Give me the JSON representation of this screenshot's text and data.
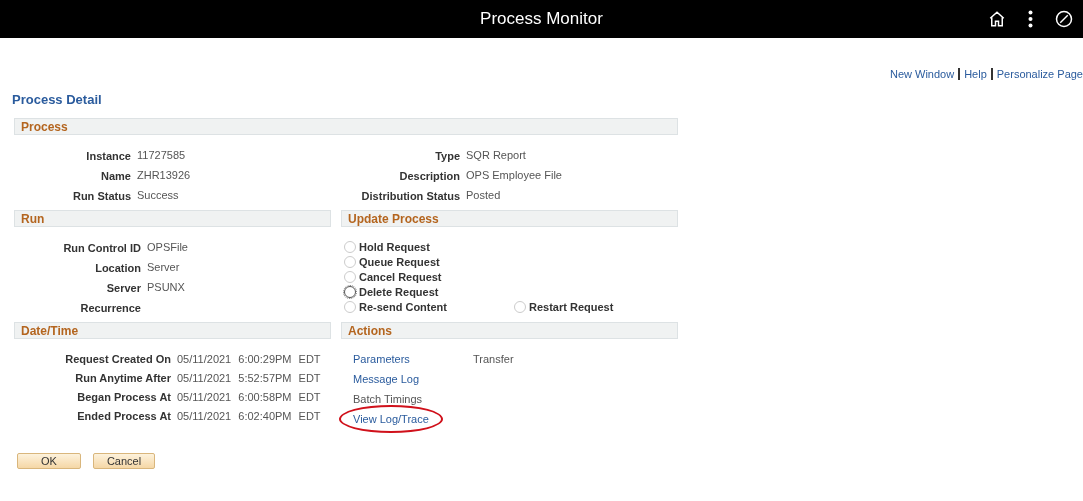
{
  "header": {
    "title": "Process Monitor"
  },
  "page_links": [
    {
      "label": "New Window"
    },
    {
      "label": "Help"
    },
    {
      "label": "Personalize Page"
    }
  ],
  "page_title": "Process Detail",
  "process": {
    "title": "Process",
    "left": [
      {
        "label": "Instance",
        "value": "11727585"
      },
      {
        "label": "Name",
        "value": "ZHR13926"
      },
      {
        "label": "Run Status",
        "value": "Success"
      }
    ],
    "right": [
      {
        "label": "Type",
        "value": "SQR Report"
      },
      {
        "label": "Description",
        "value": "OPS Employee File"
      },
      {
        "label": "Distribution Status",
        "value": "Posted"
      }
    ]
  },
  "run": {
    "title": "Run",
    "fields": [
      {
        "label": "Run Control ID",
        "value": "OPSFile"
      },
      {
        "label": "Location",
        "value": "Server"
      },
      {
        "label": "Server",
        "value": "PSUNX"
      },
      {
        "label": "Recurrence"
      }
    ]
  },
  "update_process": {
    "title": "Update Process",
    "options": [
      {
        "label": "Hold Request",
        "selected": false,
        "focused": false
      },
      {
        "label": "Queue Request",
        "selected": false,
        "focused": false
      },
      {
        "label": "Cancel Request",
        "selected": false,
        "focused": false
      },
      {
        "label": "Delete Request",
        "selected": false,
        "focused": true
      },
      {
        "label": "Re-send Content",
        "selected": false,
        "focused": false
      },
      {
        "label": "Restart Request",
        "selected": false,
        "focused": false
      }
    ]
  },
  "date_time": {
    "title": "Date/Time",
    "fields": [
      {
        "label": "Request Created On",
        "date": "05/11/2021",
        "time": "6:00:29PM EDT"
      },
      {
        "label": "Run Anytime After",
        "date": "05/11/2021",
        "time": "5:52:57PM EDT"
      },
      {
        "label": "Began Process At",
        "date": "05/11/2021",
        "time": "6:00:58PM EDT"
      },
      {
        "label": "Ended Process At",
        "date": "05/11/2021",
        "time": "6:02:40PM EDT"
      }
    ]
  },
  "actions": {
    "title": "Actions",
    "column_1": [
      {
        "label": "Parameters",
        "disabled": false,
        "circled": false
      },
      {
        "label": "Message Log",
        "disabled": false,
        "circled": false
      },
      {
        "label": "Batch Timings",
        "disabled": true,
        "circled": false
      },
      {
        "label": "View Log/Trace",
        "disabled": false,
        "circled": true
      }
    ],
    "column_2": [
      {
        "label": "Transfer",
        "disabled": true,
        "circled": false
      }
    ]
  },
  "buttons": [
    {
      "label": "OK"
    },
    {
      "label": "Cancel"
    }
  ]
}
